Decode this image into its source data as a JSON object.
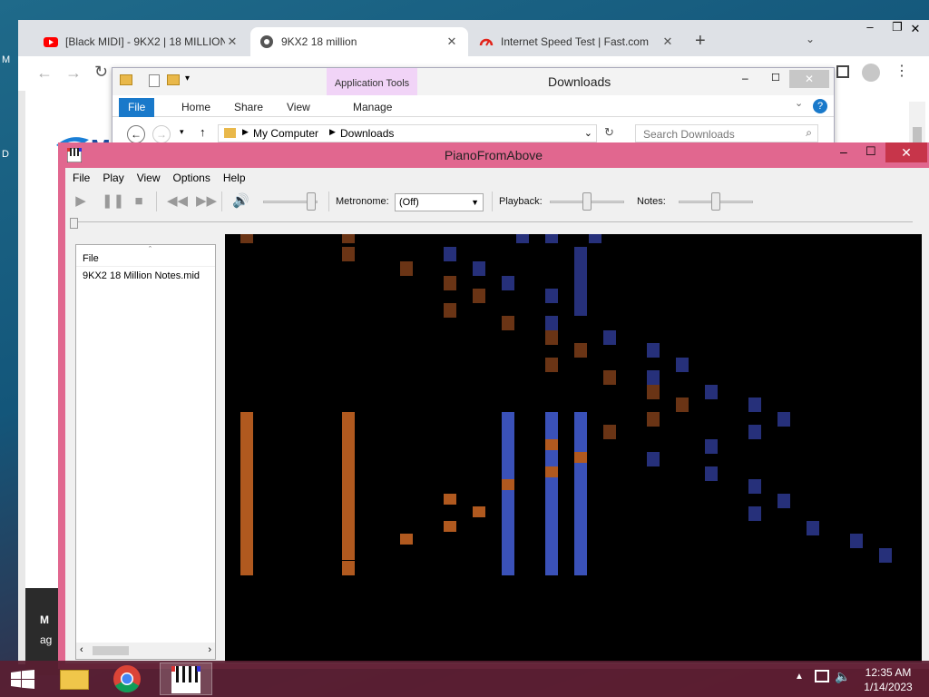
{
  "desktop": {
    "left_letters": [
      "M",
      "D"
    ]
  },
  "chrome": {
    "tabs": [
      {
        "title": "[Black MIDI] - 9KX2 | 18 MILLION",
        "icon": "youtube-icon"
      },
      {
        "title": "9KX2 18 million",
        "icon": "globe-icon"
      },
      {
        "title": "Internet Speed Test | Fast.com",
        "icon": "speedometer-icon"
      }
    ],
    "new_tab": "+",
    "page_text_1": "M",
    "page_text_2": "ag"
  },
  "explorer": {
    "title": "Downloads",
    "context_tab": "Application Tools",
    "ribbon_tabs": [
      "File",
      "Home",
      "Share",
      "View",
      "Manage"
    ],
    "breadcrumb": [
      "My Computer",
      "Downloads"
    ],
    "search_placeholder": "Search Downloads"
  },
  "piano": {
    "title": "PianoFromAbove",
    "menu": [
      "File",
      "Play",
      "View",
      "Options",
      "Help"
    ],
    "metronome_label": "Metronome:",
    "metronome_value": "(Off)",
    "playback_label": "Playback:",
    "notes_label": "Notes:",
    "volume_level": 0.95,
    "playback_level": 0.5,
    "notes_level": 0.5,
    "file_header": "File",
    "files": [
      "9KX2 18 Million Notes.mid"
    ]
  },
  "taskbar": {
    "time": "12:35 AM",
    "date": "1/14/2023"
  }
}
